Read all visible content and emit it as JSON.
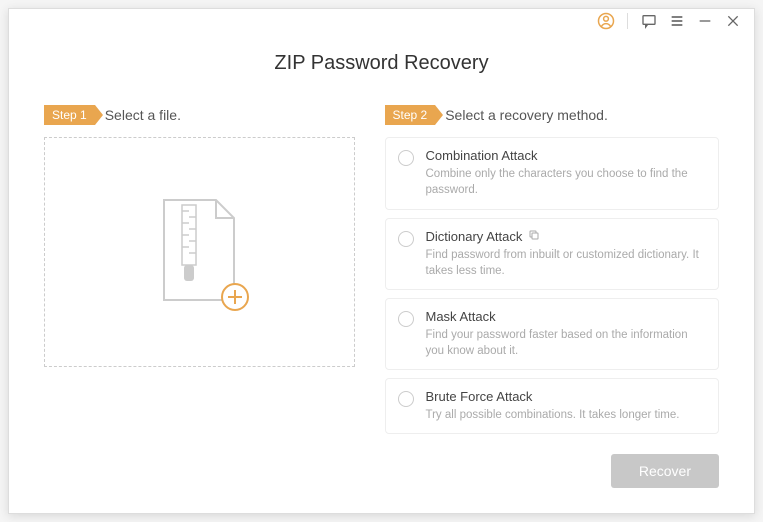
{
  "titlebar": {
    "user_icon": "user",
    "chat_icon": "chat",
    "menu_icon": "menu",
    "minimize_icon": "minimize",
    "close_icon": "close"
  },
  "page_title": "ZIP Password Recovery",
  "step1": {
    "tag": "Step 1",
    "label": "Select a file."
  },
  "step2": {
    "tag": "Step 2",
    "label": "Select a recovery method."
  },
  "methods": [
    {
      "title": "Combination Attack",
      "desc": "Combine only the characters you choose to find the password."
    },
    {
      "title": "Dictionary Attack",
      "desc": "Find password from inbuilt or customized dictionary. It takes less time."
    },
    {
      "title": "Mask Attack",
      "desc": "Find your password faster based on the information you know about it."
    },
    {
      "title": "Brute Force Attack",
      "desc": "Try all possible combinations. It takes longer time."
    }
  ],
  "footer": {
    "recover_label": "Recover"
  }
}
